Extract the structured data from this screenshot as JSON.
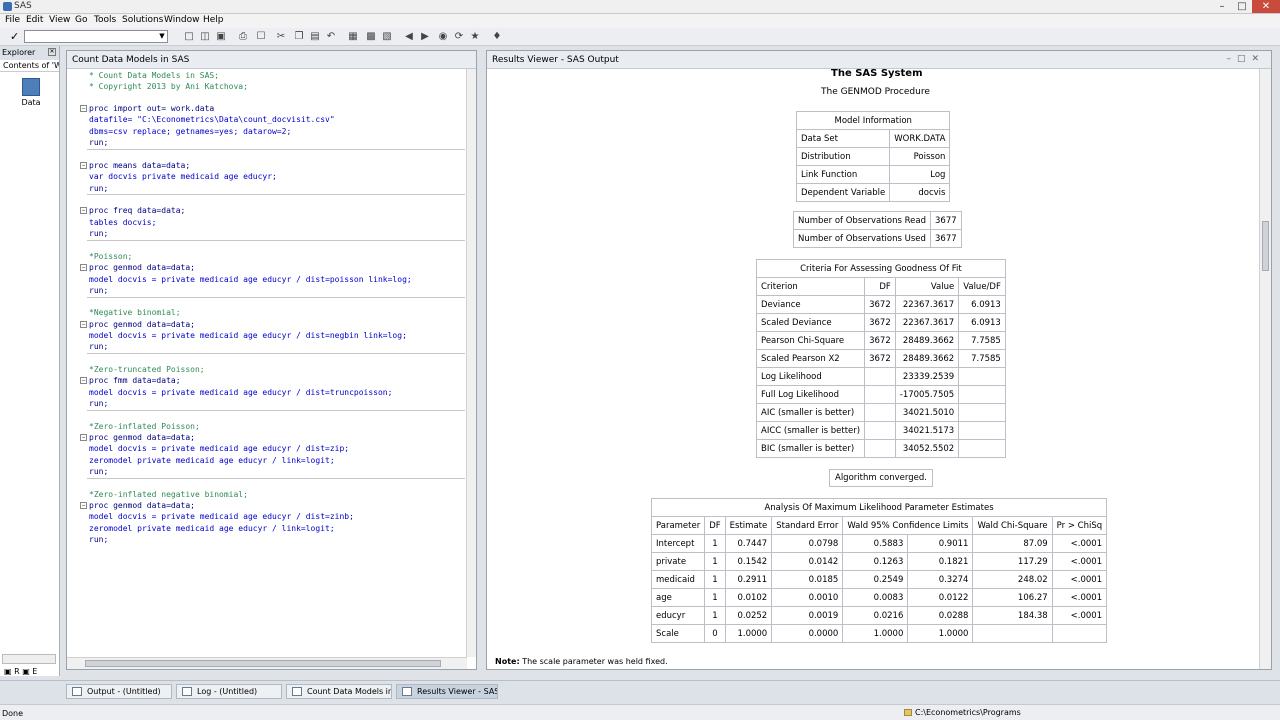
{
  "window": {
    "title": "SAS"
  },
  "menu": [
    "File",
    "Edit",
    "View",
    "Go",
    "Tools",
    "Solutions",
    "Window",
    "Help"
  ],
  "explorer": {
    "title": "Explorer",
    "tab": "Contents of 'Wo",
    "item": "Data"
  },
  "editor": {
    "title": "Count Data Models in SAS",
    "lines": [
      "* Count Data Models in SAS;",
      "* Copyright 2013 by Ani Katchova;",
      "proc import out= work.data",
      "datafile= \"C:\\Econometrics\\Data\\count_docvisit.csv\"",
      "dbms=csv replace; getnames=yes; datarow=2;",
      "run;",
      "proc means data=data;",
      "var docvis private medicaid age educyr;",
      "run;",
      "proc freq data=data;",
      "tables docvis;",
      "run;",
      "*Poisson;",
      "proc genmod data=data;",
      "model docvis = private medicaid age educyr / dist=poisson link=log;",
      "run;",
      "*Negative binomial;",
      "proc genmod data=data;",
      "model docvis = private medicaid age educyr / dist=negbin link=log;",
      "run;",
      "*Zero-truncated Poisson;",
      "proc fmm data=data;",
      "model docvis = private medicaid age educyr / dist=truncpoisson;",
      "run;",
      "*Zero-inflated Poisson;",
      "proc genmod data=data;",
      "model docvis = private medicaid age educyr / dist=zip;",
      "zeromodel private medicaid age educyr / link=logit;",
      "run;",
      "*Zero-inflated negative binomial;",
      "proc genmod data=data;",
      "model docvis = private medicaid age educyr / dist=zinb;",
      "zeromodel private medicaid age educyr / link=logit;",
      "run;"
    ]
  },
  "results": {
    "title": "Results Viewer - SAS Output",
    "system_title": "The SAS System",
    "procedure": "The GENMOD Procedure",
    "model_info": {
      "caption": "Model Information",
      "rows": [
        [
          "Data Set",
          "WORK.DATA"
        ],
        [
          "Distribution",
          "Poisson"
        ],
        [
          "Link Function",
          "Log"
        ],
        [
          "Dependent Variable",
          "docvis"
        ]
      ]
    },
    "observations": [
      [
        "Number of Observations Read",
        "3677"
      ],
      [
        "Number of Observations Used",
        "3677"
      ]
    ],
    "gof": {
      "caption": "Criteria For Assessing Goodness Of Fit",
      "headers": [
        "Criterion",
        "DF",
        "Value",
        "Value/DF"
      ],
      "rows": [
        [
          "Deviance",
          "3672",
          "22367.3617",
          "6.0913"
        ],
        [
          "Scaled Deviance",
          "3672",
          "22367.3617",
          "6.0913"
        ],
        [
          "Pearson Chi-Square",
          "3672",
          "28489.3662",
          "7.7585"
        ],
        [
          "Scaled Pearson X2",
          "3672",
          "28489.3662",
          "7.7585"
        ],
        [
          "Log Likelihood",
          "",
          "23339.2539",
          ""
        ],
        [
          "Full Log Likelihood",
          "",
          "-17005.7505",
          ""
        ],
        [
          "AIC (smaller is better)",
          "",
          "34021.5010",
          ""
        ],
        [
          "AICC (smaller is better)",
          "",
          "34021.5173",
          ""
        ],
        [
          "BIC (smaller is better)",
          "",
          "34052.5502",
          ""
        ]
      ]
    },
    "converged": "Algorithm converged.",
    "params": {
      "caption": "Analysis Of Maximum Likelihood Parameter Estimates",
      "headers": [
        "Parameter",
        "DF",
        "Estimate",
        "Standard Error",
        "Wald 95% Confidence Limits",
        "Wald Chi-Square",
        "Pr > ChiSq"
      ],
      "rows": [
        [
          "Intercept",
          "1",
          "0.7447",
          "0.0798",
          "0.5883",
          "0.9011",
          "87.09",
          "<.0001"
        ],
        [
          "private",
          "1",
          "0.1542",
          "0.0142",
          "0.1263",
          "0.1821",
          "117.29",
          "<.0001"
        ],
        [
          "medicaid",
          "1",
          "0.2911",
          "0.0185",
          "0.2549",
          "0.3274",
          "248.02",
          "<.0001"
        ],
        [
          "age",
          "1",
          "0.0102",
          "0.0010",
          "0.0083",
          "0.0122",
          "106.27",
          "<.0001"
        ],
        [
          "educyr",
          "1",
          "0.0252",
          "0.0019",
          "0.0216",
          "0.0288",
          "184.38",
          "<.0001"
        ],
        [
          "Scale",
          "0",
          "1.0000",
          "0.0000",
          "1.0000",
          "1.0000",
          "",
          ""
        ]
      ]
    },
    "note_label": "Note:",
    "note_text": "The scale parameter was held fixed."
  },
  "taskbar": [
    "Output - (Untitled)",
    "Log - (Untitled)",
    "Count Data Models in S...",
    "Results Viewer - SAS ..."
  ],
  "status": {
    "left": "Done",
    "path": "C:\\Econometrics\\Programs"
  }
}
